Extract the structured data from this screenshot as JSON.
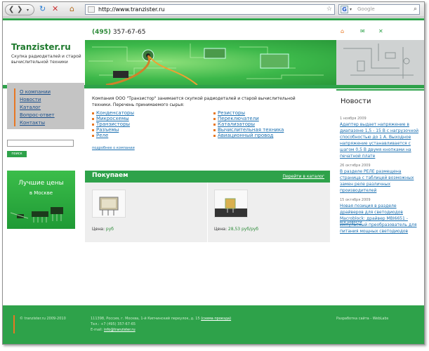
{
  "browser": {
    "url": "http://www.tranzister.ru",
    "search_placeholder": "Google",
    "search_engine_letter": "G"
  },
  "header": {
    "phone_code": "(495)",
    "phone_number": "357-67-65",
    "logo": "Tranzister.ru",
    "slogan": "Скупка радиодеталей и старой вычислительной техники"
  },
  "menu": {
    "items": [
      {
        "label": "О компании"
      },
      {
        "label": "Новости"
      },
      {
        "label": "Каталог"
      },
      {
        "label": "Вопрос-ответ"
      },
      {
        "label": "Контакты"
      }
    ],
    "search_button": "поиск"
  },
  "promo": {
    "line1": "Лучшие цены",
    "line2": "в Москве"
  },
  "intro": {
    "text": "Компания ООО \"Транзистор\" занимается скупкой радиодеталей и старой вычислительной техники. Перечень принимаемого сырья:",
    "more": "подробнее о компании"
  },
  "categories": {
    "left": [
      "Конденсаторы",
      "Микросхемы",
      "Транзисторы",
      "Разъемы",
      "Реле"
    ],
    "right": [
      "Резисторы",
      "Переключатели",
      "Катализаторы",
      "Вычислительная техника",
      "Авиационный провод"
    ]
  },
  "shop": {
    "title": "Покупаем",
    "catalog_link": "Перейти в каталог",
    "products": [
      {
        "price_label": "Цена:",
        "price_value": "руб"
      },
      {
        "price_label": "Цена:",
        "price_value": "28,53 руб/руб"
      }
    ]
  },
  "news": {
    "title": "Новости",
    "items": [
      {
        "date": "1 ноября 2009",
        "text": "Адаптер выдает напряжение в диапазоне 1,5 - 15 В с нагрузочной способностью до 1 А. Выходное напряжение устанавливается с шагом 0,5 В двумя кнопками на печатной плате"
      },
      {
        "date": "26 октября 2009",
        "text": "В разделе РЕЛЕ размещена страница с таблицей возможных замен реле различных производителей"
      },
      {
        "date": "15 октября 2009",
        "text": "Новая позиция в разделе драйверов для светодиодов Macroblock: драйвер MBI6651 - импульсный преобразователь для питания мощных светодиодов"
      }
    ],
    "all": "все новости"
  },
  "footer": {
    "copyright": "© tranzister.ru 2009-2010",
    "address": "111398, Россия, г. Москва, 1-й Кипчинский переулок, д. 15",
    "map_link": "(схема проезда)",
    "phone": "Тел.: +7 (495) 357-67-65",
    "email_label": "E-mail:",
    "email": "info@tranzister.ru",
    "developer": "Разработка сайта - WebLabs"
  },
  "colors": {
    "brand_green": "#2ea24a",
    "accent_orange": "#e87722",
    "link_blue": "#1a6fb0"
  }
}
